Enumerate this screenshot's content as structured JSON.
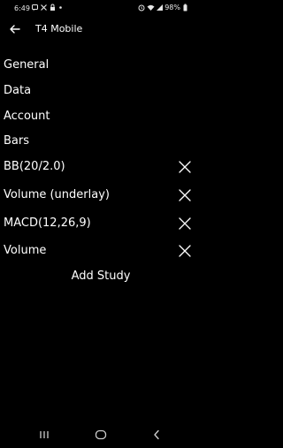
{
  "status_bar": {
    "time": "6:49",
    "battery": "98%",
    "left_icons": [
      "message-icon",
      "x-icon",
      "lock-icon",
      "dot-icon"
    ],
    "right_icons": [
      "alarm-icon",
      "wifi-icon",
      "signal-icon",
      "battery-icon"
    ]
  },
  "app_bar": {
    "title": "T4 Mobile",
    "back_icon": "back-arrow-icon"
  },
  "menu": {
    "items": [
      {
        "label": "General"
      },
      {
        "label": "Data"
      },
      {
        "label": "Account"
      },
      {
        "label": "Bars"
      }
    ]
  },
  "studies": {
    "items": [
      {
        "label": "BB(20/2.0)"
      },
      {
        "label": "Volume (underlay)"
      },
      {
        "label": "MACD(12,26,9)"
      },
      {
        "label": "Volume"
      }
    ],
    "remove_icon": "close-icon",
    "add_label": "Add Study"
  },
  "nav": {
    "buttons": [
      "recents-icon",
      "home-icon",
      "back-icon"
    ]
  }
}
